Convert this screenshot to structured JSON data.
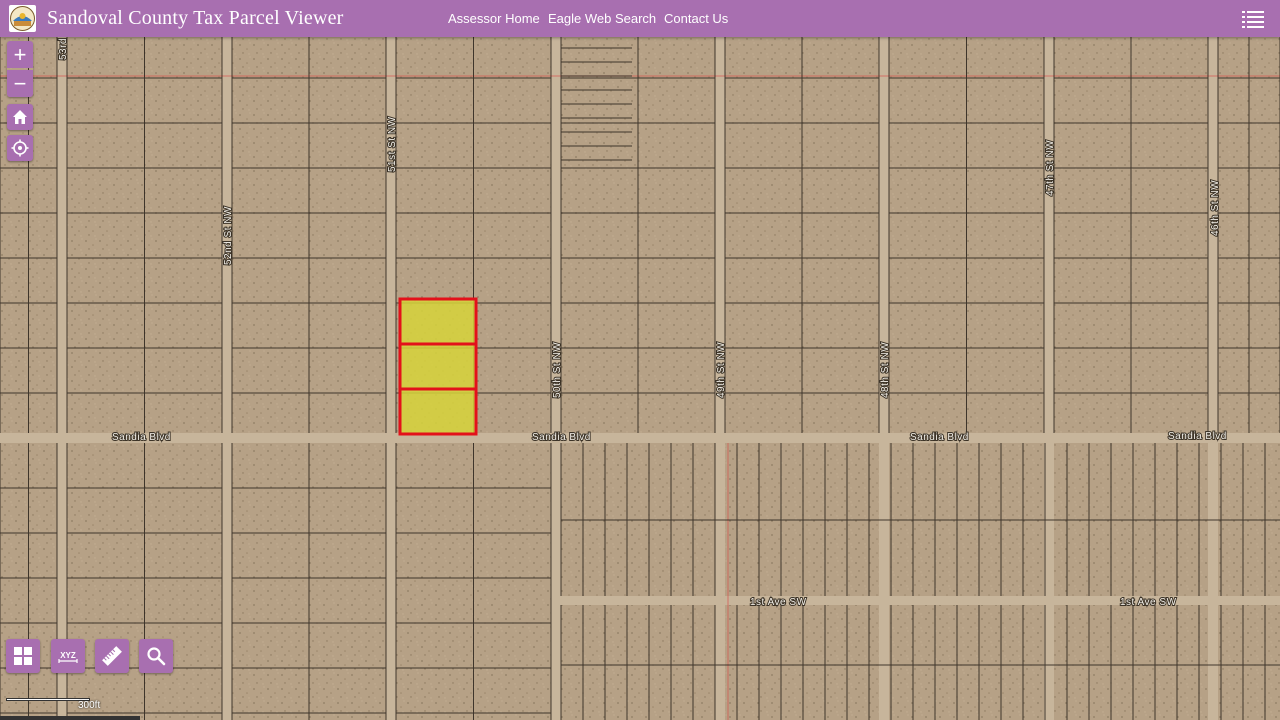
{
  "header": {
    "title": "Sandoval County Tax Parcel Viewer",
    "nav": [
      {
        "label": "Assessor Home"
      },
      {
        "label": "Eagle Web Search"
      },
      {
        "label": "Contact Us"
      }
    ]
  },
  "map": {
    "scale_label": "300ft",
    "streets": {
      "s53": "53rd",
      "s52": "52nd St NW",
      "s51": "51st St NW",
      "s50": "50th St NW",
      "s49": "49th St NW",
      "s48": "48th St NW",
      "s47": "47th St NW",
      "s46": "46th St NW",
      "sandia1": "Sandia Blvd",
      "sandia2": "Sandia Blvd",
      "sandia3": "Sandia Blvd",
      "sandia4": "Sandia Blvd",
      "first1": "1st Ave SW",
      "first2": "1st Ave SW"
    },
    "selection_fill": "#d7d43a",
    "selection_outline": "#e3111a",
    "parcel_line_color": "#2a231c",
    "section_line_color": "#d9534f"
  },
  "colors": {
    "header_bg": "#a86fb0",
    "terrain": "#b6a186"
  },
  "icons": {
    "zoom_in": "+",
    "zoom_out": "−"
  }
}
